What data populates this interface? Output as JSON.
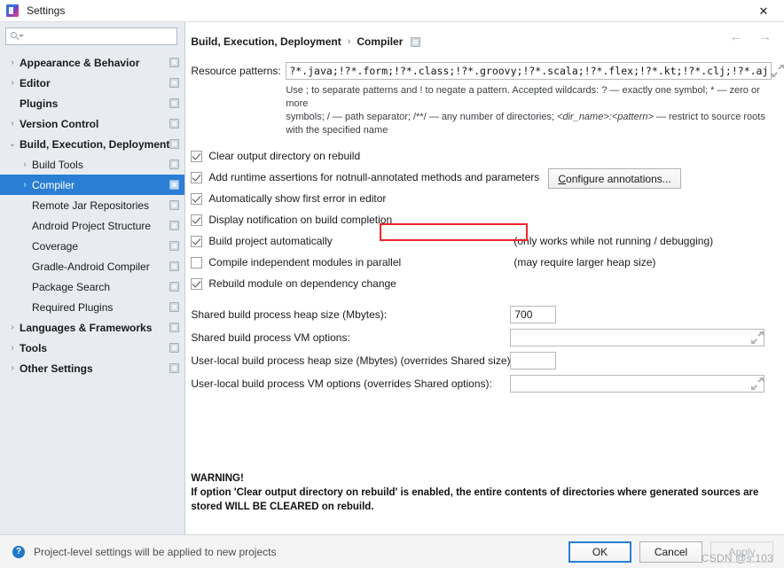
{
  "window": {
    "title": "Settings",
    "app_icon": "intellij-idea-icon",
    "close_label": "✕"
  },
  "sidebar": {
    "search": {
      "placeholder": "",
      "value": "",
      "icon": "search-icon"
    },
    "items": [
      {
        "label": "Appearance & Behavior",
        "level": 0,
        "twisty": "›",
        "bold": true,
        "badge": true,
        "selected": false
      },
      {
        "label": "Editor",
        "level": 0,
        "twisty": "›",
        "bold": true,
        "badge": true,
        "selected": false
      },
      {
        "label": "Plugins",
        "level": 0,
        "twisty": "",
        "bold": true,
        "badge": true,
        "selected": false
      },
      {
        "label": "Version Control",
        "level": 0,
        "twisty": "›",
        "bold": true,
        "badge": true,
        "selected": false
      },
      {
        "label": "Build, Execution, Deployment",
        "level": 0,
        "twisty": "⌄",
        "bold": true,
        "badge": true,
        "selected": false
      },
      {
        "label": "Build Tools",
        "level": 1,
        "twisty": "›",
        "bold": false,
        "badge": true,
        "selected": false
      },
      {
        "label": "Compiler",
        "level": 1,
        "twisty": "›",
        "bold": false,
        "badge": true,
        "selected": true
      },
      {
        "label": "Remote Jar Repositories",
        "level": 2,
        "twisty": "",
        "bold": false,
        "badge": true,
        "selected": false
      },
      {
        "label": "Android Project Structure",
        "level": 2,
        "twisty": "",
        "bold": false,
        "badge": true,
        "selected": false
      },
      {
        "label": "Coverage",
        "level": 2,
        "twisty": "",
        "bold": false,
        "badge": true,
        "selected": false
      },
      {
        "label": "Gradle-Android Compiler",
        "level": 2,
        "twisty": "",
        "bold": false,
        "badge": true,
        "selected": false
      },
      {
        "label": "Package Search",
        "level": 2,
        "twisty": "",
        "bold": false,
        "badge": true,
        "selected": false
      },
      {
        "label": "Required Plugins",
        "level": 2,
        "twisty": "",
        "bold": false,
        "badge": true,
        "selected": false
      },
      {
        "label": "Languages & Frameworks",
        "level": 0,
        "twisty": "›",
        "bold": true,
        "badge": true,
        "selected": false
      },
      {
        "label": "Tools",
        "level": 0,
        "twisty": "›",
        "bold": true,
        "badge": true,
        "selected": false
      },
      {
        "label": "Other Settings",
        "level": 0,
        "twisty": "›",
        "bold": true,
        "badge": true,
        "selected": false
      }
    ]
  },
  "content": {
    "breadcrumb": {
      "root": "Build, Execution, Deployment",
      "separator": "›",
      "leaf": "Compiler"
    },
    "nav": {
      "back": "←",
      "forward": "→"
    },
    "resource_patterns": {
      "label": "Resource patterns:",
      "value": "?*.java;!?*.form;!?*.class;!?*.groovy;!?*.scala;!?*.flex;!?*.kt;!?*.clj;!?*.aj",
      "expand_icon": "expand-icon"
    },
    "help": {
      "line1": "Use ; to separate patterns and ! to negate a pattern. Accepted wildcards: ? — exactly one symbol; * — zero or more",
      "line2_a": "symbols; / — path separator; /**/ — any number of directories; ",
      "line2_italic": "<dir_name>:<pattern>",
      "line2_b": " — restrict to source roots",
      "line3": "with the specified name"
    },
    "checkboxes": [
      {
        "label": "Clear output directory on rebuild",
        "checked": true,
        "hint": "",
        "mnemonic_index": 1
      },
      {
        "label": "Add runtime assertions for notnull-annotated methods and parameters",
        "checked": true,
        "hint": "",
        "mnemonic_index": 12
      },
      {
        "label": "Automatically show first error in editor",
        "checked": true,
        "hint": "",
        "mnemonic_index": 24
      },
      {
        "label": "Display notification on build completion",
        "checked": true,
        "hint": "",
        "mnemonic_index": -1
      },
      {
        "label": "Build project automatically",
        "checked": true,
        "hint": "(only works while not running / debugging)",
        "mnemonic_index": -1
      },
      {
        "label": "Compile independent modules in parallel",
        "checked": false,
        "hint": "(may require larger heap size)",
        "mnemonic_index": -1
      },
      {
        "label": "Rebuild module on dependency change",
        "checked": true,
        "hint": "",
        "mnemonic_index": -1
      }
    ],
    "configure_annotations_button": {
      "prefix": "C",
      "rest": "onfigure annotations..."
    },
    "fields": [
      {
        "label": "Shared build process heap size (Mbytes):",
        "value": "700",
        "type": "small"
      },
      {
        "label": "Shared build process VM options:",
        "value": "",
        "type": "wide"
      },
      {
        "label": "User-local build process heap size (Mbytes) (overrides Shared size):",
        "value": "",
        "type": "small"
      },
      {
        "label": "User-local build process VM options (overrides Shared options):",
        "value": "",
        "type": "wide"
      }
    ],
    "warning": {
      "title": "WARNING!",
      "line1": "If option 'Clear output directory on rebuild' is enabled, the entire contents of directories where generated sources are",
      "line2": "stored WILL BE CLEARED on rebuild."
    }
  },
  "footer": {
    "help_icon": "?",
    "status_text": "Project-level settings will be applied to new projects",
    "ok_label": "OK",
    "cancel_label": "Cancel",
    "apply_label": "Apply",
    "watermark": "CSDN @s:103"
  },
  "colors": {
    "selection_blue": "#2a7fd4",
    "sidebar_bg": "#e8ecf1",
    "highlight_red": "#f0242b",
    "primary_border": "#2b7fd4"
  }
}
